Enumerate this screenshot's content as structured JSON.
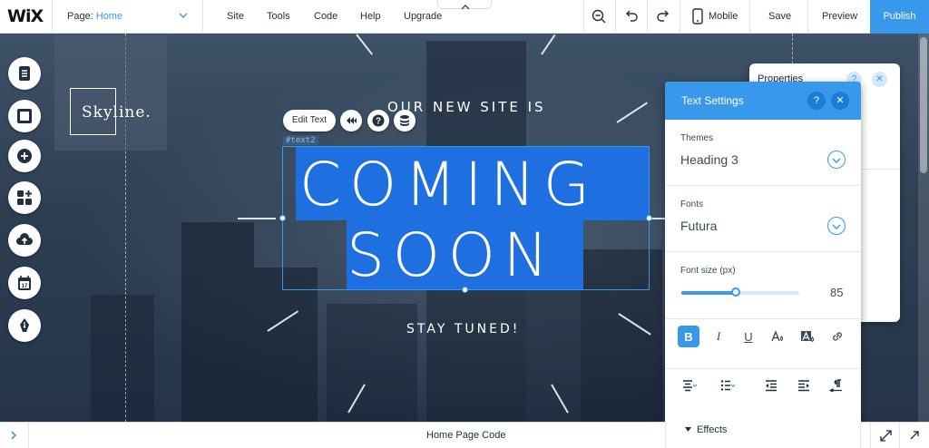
{
  "topbar": {
    "logo": "WiX",
    "page_label": "Page:",
    "page_value": "Home",
    "menu": [
      "Site",
      "Tools",
      "Code",
      "Help",
      "Upgrade"
    ],
    "mobile_label": "Mobile",
    "save_label": "Save",
    "preview_label": "Preview",
    "publish_label": "Publish"
  },
  "left_tools": [
    "pages-icon",
    "background-icon",
    "add-icon",
    "add-apps-icon",
    "upload-icon",
    "bookings-icon",
    "blog-pen-icon"
  ],
  "stage": {
    "logo_text": "Skyline.",
    "headline_top": "OUR NEW SITE IS",
    "headline_line1": "COMING",
    "headline_line2": "SOON",
    "headline_bottom": "STAY TUNED!",
    "component_tag": "#text2",
    "edit_text_label": "Edit Text"
  },
  "properties_panel": {
    "title": "Properties",
    "help": "?",
    "close": "✕"
  },
  "text_settings": {
    "title": "Text Settings",
    "help": "?",
    "close": "✕",
    "themes_label": "Themes",
    "themes_value": "Heading 3",
    "fonts_label": "Fonts",
    "fonts_value": "Futura",
    "font_size_label": "Font size (px)",
    "font_size_value": "85",
    "font_size_slider_fraction": 0.46,
    "bold": "B",
    "italic": "I",
    "underline": "U",
    "effects_label": "Effects"
  },
  "bottombar": {
    "title": "Home Page Code"
  },
  "colors": {
    "accent": "#3899ec",
    "highlight": "#1e6fe0"
  }
}
